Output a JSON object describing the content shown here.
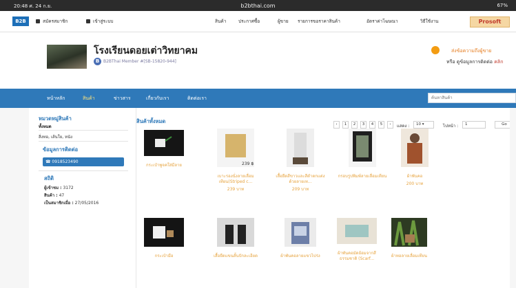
{
  "statusbar": {
    "time": "20:48 ศ. 24 ก.ย.",
    "url": "b2bthai.com",
    "battery": "67%"
  },
  "topnav": {
    "logo": "B2B",
    "register": "สมัครสมาชิก",
    "login": "เข้าสู่ระบบ",
    "links": [
      "สินค้า",
      "ประกาศซื้อ",
      "ผู้ขาย",
      "รายการขอราคาสินค้า",
      "อัตราค่าโฆษณา",
      "วิธีใช้งาน"
    ],
    "prosoft": "Prosoft"
  },
  "header": {
    "shop_name": "โรงเรียนดอยเต่าวิทยาคม",
    "member": "B2BThai Member #[SB-15820-944]",
    "send_message": "ส่งข้อความถึงผู้ขาย",
    "contact_prefix": "หรือ ดูข้อมูลการติดต่อ",
    "contact_link": "คลิก"
  },
  "mainnav": {
    "items": [
      "หน้าหลัก",
      "สินค้า",
      "ข่าวสาร",
      "เกี่ยวกับเรา",
      "ติดต่อเรา"
    ],
    "search_placeholder": "ค้นหาสินค้า"
  },
  "sidebar": {
    "category_title": "หมวดหมู่สินค้า",
    "category_all": "ทั้งหมด",
    "category_item": "สิ่งทอ, เส้นใย, หนัง",
    "contact_title": "ข้อมูลการติดต่อ",
    "phone": "0918523490",
    "stats_title": "สถิติ",
    "visitors_label": "ผู้เข้าชม :",
    "visitors": "3172",
    "products_label": "สินค้า :",
    "products": "47",
    "member_since_label": "เป็นสมาชิกเมื่อ :",
    "member_since": "27/05/2016"
  },
  "main": {
    "title": "สินค้าทั้งหมด",
    "pages": [
      "1",
      "2",
      "3",
      "4",
      "5"
    ],
    "show_label": "แสดง :",
    "show_value": "10",
    "goto_label": "ไปหน้า :",
    "goto_value": "1",
    "go": "Go",
    "products": [
      {
        "title": "กระเป๋าพูจคใส่มีลาย",
        "price": ""
      },
      {
        "title": "เบาะรองนั่งลายเลื่อมเทียน(Striped c...",
        "price": "239 บาท"
      },
      {
        "title": "เสื้อยืดสีขาวและสีดำตกแต่งด้วยลายเท...",
        "price": "209 บาท"
      },
      {
        "title": "กรอบรูปพิมพ์ลายเลื่อมเทียน",
        "price": ""
      },
      {
        "title": "ผ้าพันคอ",
        "price": "200 บาท"
      },
      {
        "title": "กระเป๋ามือ",
        "price": ""
      },
      {
        "title": "เสื้อยืดแขนสั้นปักละเอียด",
        "price": ""
      },
      {
        "title": "ผ้าพันคอลายแขวไปร่ง",
        "price": ""
      },
      {
        "title": "ผ้าพันคอมัดย้อมจากสีธรรมชาติ (Scarf...",
        "price": ""
      },
      {
        "title": "ผ้าทอลายเลื่อมเทียน",
        "price": ""
      }
    ],
    "product2_tag": "239 ฿"
  }
}
